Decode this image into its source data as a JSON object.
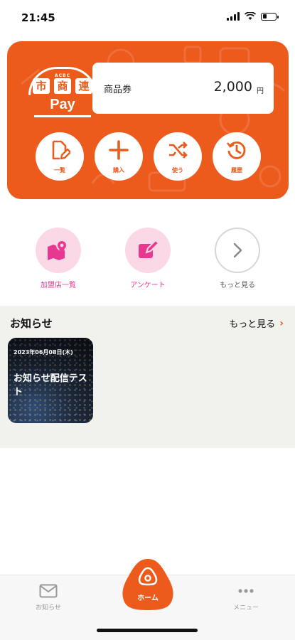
{
  "status": {
    "time": "21:45",
    "battery_level": 0.35
  },
  "card": {
    "logo": {
      "small_text": "ACBC",
      "kanji": [
        "市",
        "商",
        "連"
      ],
      "pay": "Pay"
    },
    "balance": {
      "label": "商品券",
      "amount": "2,000",
      "unit": "円"
    },
    "actions": [
      {
        "label": "一覧",
        "icon": "edit-document-icon"
      },
      {
        "label": "購入",
        "icon": "plus-icon"
      },
      {
        "label": "使う",
        "icon": "shuffle-icon"
      },
      {
        "label": "履歴",
        "icon": "history-icon"
      }
    ]
  },
  "quick_links": [
    {
      "label": "加盟店一覧",
      "icon": "map-pin-icon",
      "color": "#e8378f"
    },
    {
      "label": "アンケート",
      "icon": "survey-edit-icon",
      "color": "#e8378f"
    },
    {
      "label": "もっと見る",
      "icon": "chevron-right-icon",
      "color": "#555555"
    }
  ],
  "news": {
    "title": "お知らせ",
    "more_label": "もっと見る",
    "items": [
      {
        "date": "2023年06月08日(木)",
        "headline": "お知らせ配信テスト"
      }
    ]
  },
  "bottom_nav": {
    "left_label": "お知らせ",
    "home_label": "ホーム",
    "right_label": "メニュー"
  },
  "colors": {
    "brand": "#ec5a1c",
    "pink": "#e8378f",
    "pink_bg": "#fbd8e6"
  }
}
